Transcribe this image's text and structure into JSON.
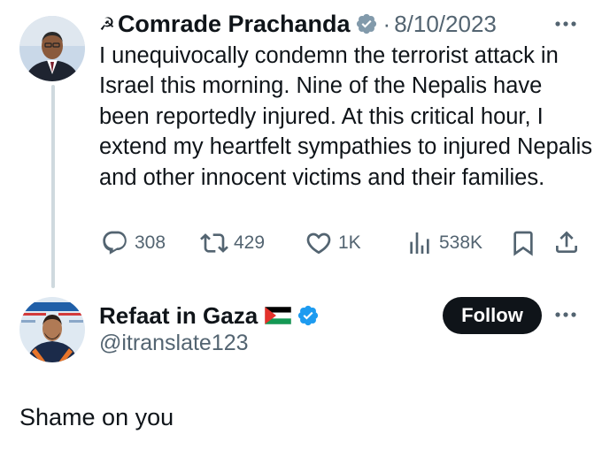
{
  "original_tweet": {
    "author_emoji": "☭",
    "author_name": "Comrade Prachanda",
    "separator": "·",
    "date": "8/10/2023",
    "text": "I unequivocally condemn the terrorist attack in Israel this morning. Nine of the Nepalis have been reportedly injured. At this critical hour, I extend my heartfelt sympathies to injured Nepalis and other innocent victims and their families.",
    "replies": "308",
    "retweets": "429",
    "likes": "1K",
    "views": "538K",
    "icons": [
      "verified-badge-gray-icon",
      "more-icon",
      "reply-icon",
      "retweet-icon",
      "like-icon",
      "views-icon",
      "bookmark-icon",
      "share-icon"
    ]
  },
  "reply": {
    "author_name": "Refaat in Gaza",
    "flag": "palestine-flag",
    "handle": "@itranslate123",
    "follow_label": "Follow",
    "text": "Shame on you",
    "icons": [
      "verified-badge-blue-icon",
      "more-icon"
    ]
  },
  "colors": {
    "text": "#0f1419",
    "muted": "#536471",
    "verified_blue": "#1d9bf0",
    "verified_gray": "#829aab",
    "thread_line": "#cfd9de",
    "follow_bg": "#0f1419"
  }
}
